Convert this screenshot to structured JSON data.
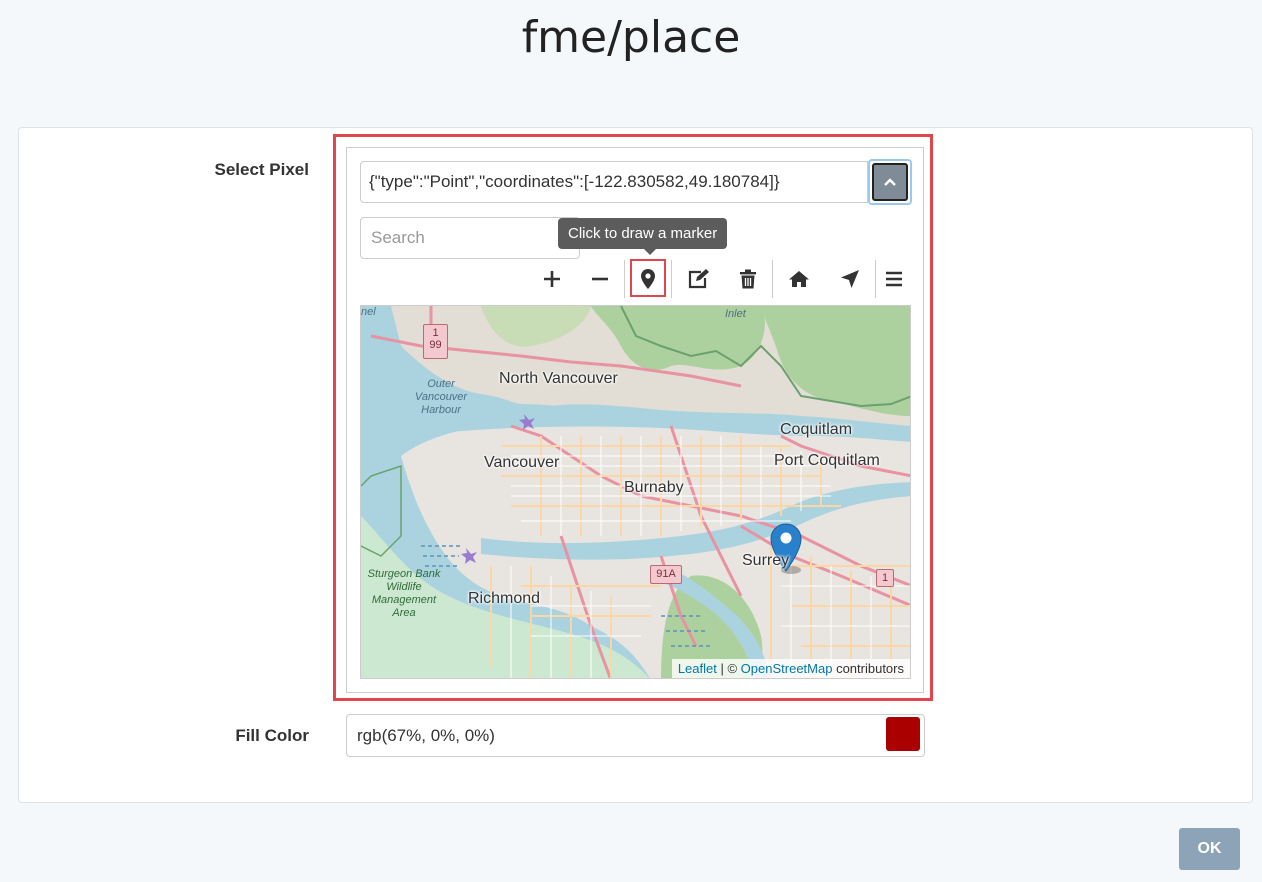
{
  "page": {
    "title": "fme/place"
  },
  "select_pixel": {
    "label": "Select Pixel",
    "geometry_value": "{\"type\":\"Point\",\"coordinates\":[-122.830582,49.180784]}",
    "collapse_icon": "chevron-up-icon",
    "search_placeholder": "Search",
    "tooltip": "Click to draw a marker",
    "toolbar": [
      {
        "name": "zoom-in-button",
        "icon": "plus-icon"
      },
      {
        "name": "zoom-out-button",
        "icon": "minus-icon"
      },
      {
        "name": "draw-marker-button",
        "icon": "map-marker-icon"
      },
      {
        "name": "edit-button",
        "icon": "edit-icon"
      },
      {
        "name": "delete-button",
        "icon": "trash-icon"
      },
      {
        "name": "home-button",
        "icon": "home-icon"
      },
      {
        "name": "locate-button",
        "icon": "location-arrow-icon"
      },
      {
        "name": "menu-button",
        "icon": "hamburger-menu-icon"
      }
    ]
  },
  "map": {
    "places": {
      "north_vancouver": "North Vancouver",
      "vancouver": "Vancouver",
      "burnaby": "Burnaby",
      "coquitlam": "Coquitlam",
      "port_coquitlam": "Port Coquitlam",
      "surrey": "Surrey",
      "richmond": "Richmond"
    },
    "water_labels": {
      "outer_harbour": "Outer Vancouver Harbour",
      "inlet": "Inlet",
      "top_left": "nel"
    },
    "park_labels": {
      "sturgeon_bank": "Sturgeon Bank Wildlife Management Area"
    },
    "highway_shields": {
      "hwy_1_99": "1\n99",
      "hwy_91a": "91A",
      "hwy_1": "1"
    },
    "marker_icon": "blue-map-pin-icon",
    "attribution": {
      "leaflet": "Leaflet",
      "separator": " | © ",
      "osm": "OpenStreetMap",
      "suffix": " contributors"
    }
  },
  "fill_color": {
    "label": "Fill Color",
    "value": "rgb(67%, 0%, 0%)",
    "swatch_color": "#aa0000"
  },
  "ok_button": {
    "label": "OK"
  },
  "colors": {
    "highlight": "#e0474c",
    "ok_button_bg": "#8ca3b8"
  }
}
